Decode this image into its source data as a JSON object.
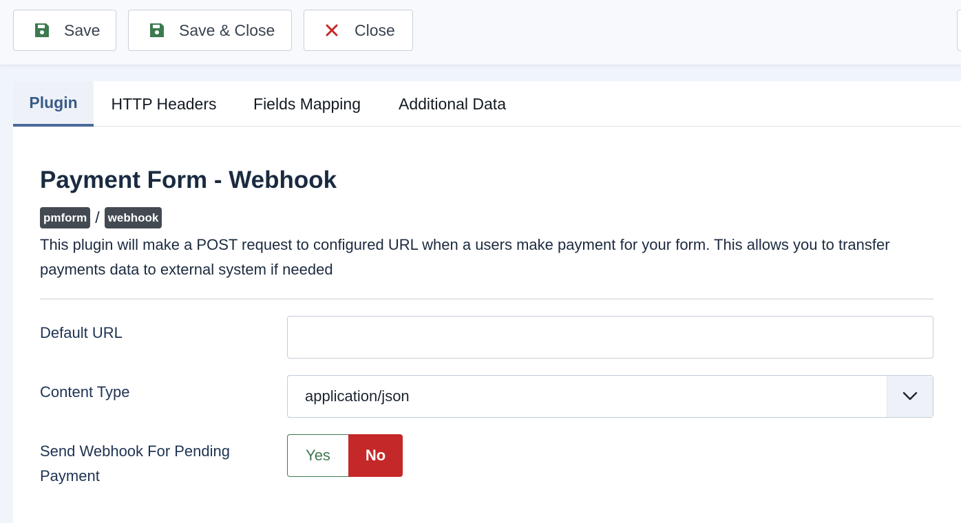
{
  "toolbar": {
    "save_label": "Save",
    "save_close_label": "Save & Close",
    "close_label": "Close",
    "save_icon": "floppy-disk-icon",
    "close_icon": "close-icon",
    "save_icon_color": "#3c7a4f",
    "close_icon_color": "#c52828"
  },
  "tabs": [
    {
      "label": "Plugin",
      "active": true
    },
    {
      "label": "HTTP Headers",
      "active": false
    },
    {
      "label": "Fields Mapping",
      "active": false
    },
    {
      "label": "Additional Data",
      "active": false
    }
  ],
  "plugin": {
    "title": "Payment Form - Webhook",
    "group_badge": "pmform",
    "separator": "/",
    "element_badge": "webhook",
    "description": "This plugin will make a POST request to configured URL when a users make payment for your form. This allows you to transfer payments data to external system if needed"
  },
  "form": {
    "default_url": {
      "label": "Default URL",
      "value": ""
    },
    "content_type": {
      "label": "Content Type",
      "value": "application/json"
    },
    "send_pending": {
      "label": "Send Webhook For Pending Payment",
      "yes_label": "Yes",
      "no_label": "No",
      "selected": "No"
    }
  },
  "colors": {
    "accent": "#4a6a99",
    "danger": "#c52828",
    "success": "#3c7a4f"
  }
}
